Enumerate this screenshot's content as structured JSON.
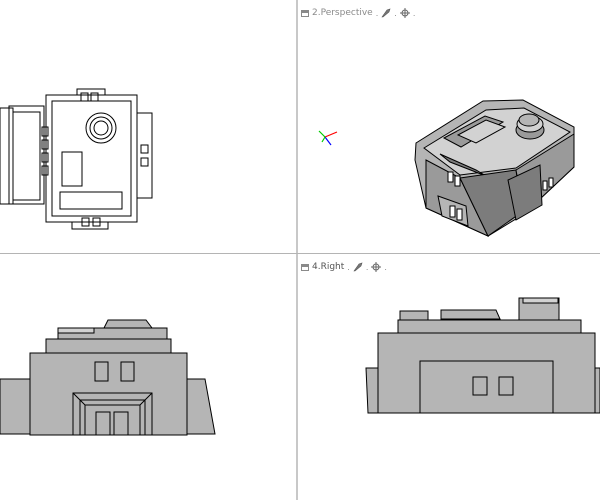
{
  "viewports": {
    "top": {
      "label": "",
      "active": false
    },
    "perspective": {
      "label": "2.Perspective",
      "active": false
    },
    "front": {
      "label": "",
      "active": false
    },
    "right": {
      "label": "4.Right",
      "active": true
    }
  },
  "header_separator": ".",
  "icons": {
    "maximize": "maximize-icon",
    "shading": "shading-mode-icon",
    "display": "display-options-icon",
    "menu": "viewport-menu-icon"
  },
  "colors": {
    "model_face": "#b5b5b5",
    "model_face_dark": "#7c7c7c",
    "divider": "#c8c8c8",
    "header_text": "#8a8a8a",
    "axis_x": "#ff0000",
    "axis_y": "#00cc00",
    "axis_z": "#0000ff"
  }
}
